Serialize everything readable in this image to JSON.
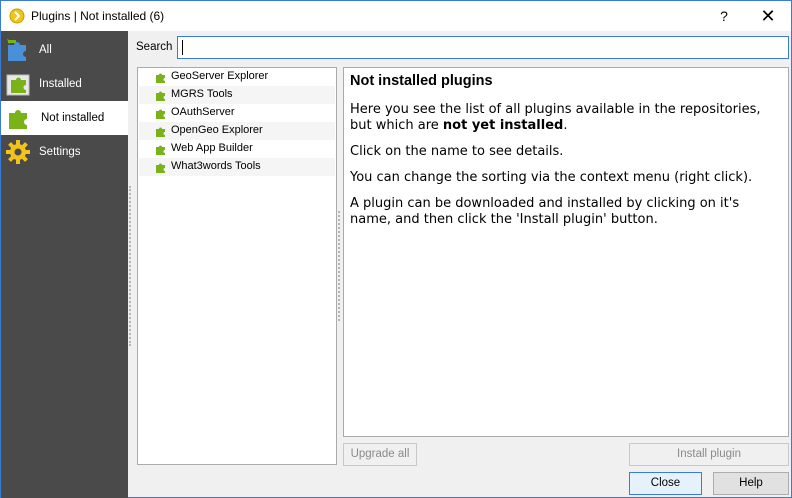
{
  "window": {
    "title": "Plugins | Not installed (6)",
    "help_glyph": "?",
    "close_glyph": "✕"
  },
  "sidebar": {
    "items": [
      {
        "label": "All",
        "icon": "puzzle-all-icon"
      },
      {
        "label": "Installed",
        "icon": "puzzle-installed-icon"
      },
      {
        "label": "Not installed",
        "icon": "puzzle-not-installed-icon",
        "selected": true
      },
      {
        "label": "Settings",
        "icon": "gear-icon"
      }
    ]
  },
  "search": {
    "label": "Search",
    "value": "",
    "placeholder": ""
  },
  "plugins": [
    {
      "name": "GeoServer Explorer"
    },
    {
      "name": "MGRS Tools"
    },
    {
      "name": "OAuthServer"
    },
    {
      "name": "OpenGeo Explorer"
    },
    {
      "name": "Web App Builder"
    },
    {
      "name": "What3words Tools"
    }
  ],
  "detail": {
    "heading": "Not installed plugins",
    "p1_pre": "Here you see the list of all plugins available in the repositories, but which are ",
    "p1_bold": "not yet installed",
    "p1_post": ".",
    "p2": "Click on the name to see details.",
    "p3": "You can change the sorting via the context menu (right click).",
    "p4": "A plugin can be downloaded and installed by clicking on it's name, and then click the 'Install plugin' button."
  },
  "buttons": {
    "upgrade_all": "Upgrade all",
    "install_plugin": "Install plugin",
    "close": "Close",
    "help": "Help"
  },
  "colors": {
    "sidebar_bg": "#4a4a4a",
    "accent": "#3a7bd5",
    "plugin_icon": "#7ab317"
  }
}
